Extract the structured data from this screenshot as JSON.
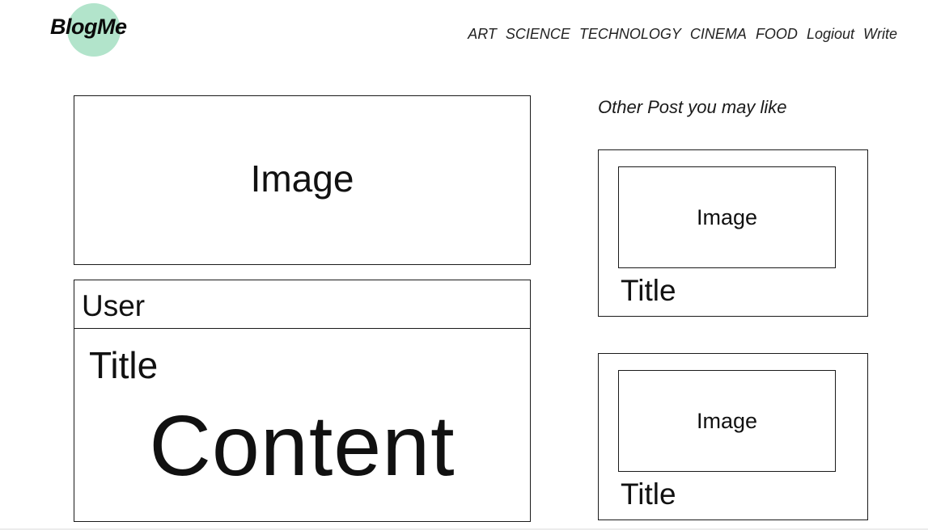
{
  "header": {
    "logo": "BlogMe",
    "logo_color": "#b2e4cb",
    "nav": [
      "ART",
      "SCIENCE",
      "TECHNOLOGY",
      "CINEMA",
      "FOOD",
      "Logiout",
      "Write"
    ]
  },
  "post": {
    "image_label": "Image",
    "user": "User",
    "title": "Title",
    "content": "Content"
  },
  "sidebar": {
    "heading": "Other Post you may like",
    "posts": [
      {
        "image_label": "Image",
        "title": "Title"
      },
      {
        "image_label": "Image",
        "title": "Title"
      }
    ]
  }
}
